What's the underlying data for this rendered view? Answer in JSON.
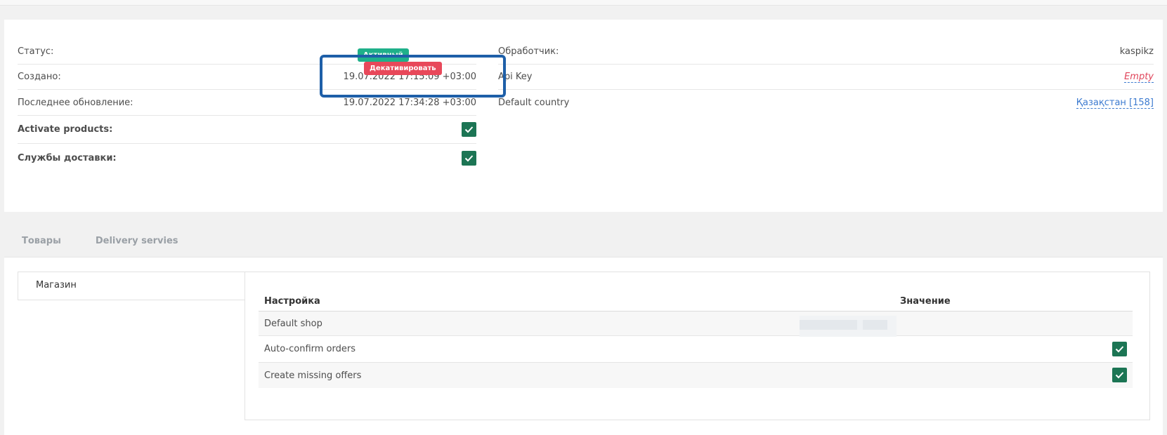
{
  "info": {
    "status_label": "Статус:",
    "status_badge": "Активный",
    "deactivate_button": "Декативировать",
    "created_label": "Создано:",
    "created_value": "19.07.2022 17:15:09 +03:00",
    "updated_label": "Последнее обновление:",
    "updated_value": "19.07.2022 17:34:28 +03:00",
    "activate_products_label": "Activate products:",
    "activate_products_checked": true,
    "delivery_services_label": "Службы доставки:",
    "delivery_services_checked": true,
    "handler_label": "Обработчик:",
    "handler_value": "kaspikz",
    "api_key_label": "Api Key",
    "api_key_value": "Empty",
    "default_country_label": "Default country",
    "default_country_value": "Қазақстан [158]"
  },
  "tabs": [
    {
      "label": "Товары"
    },
    {
      "label": "Delivery servies"
    }
  ],
  "sidebar": {
    "shop_tab": "Магазин"
  },
  "settings_table": {
    "headers": [
      "Настройка",
      "Значение"
    ],
    "rows": [
      {
        "name": "Default shop",
        "value_hidden": true
      },
      {
        "name": "Auto-confirm orders",
        "checked": true
      },
      {
        "name": "Create missing offers",
        "checked": true
      }
    ]
  },
  "colors": {
    "active_badge": "#1fb08a",
    "deactivate_badge": "#e8485a",
    "checkbox": "#1c7554",
    "highlight_box": "#1e5fa8",
    "link": "#3d7bd0",
    "empty": "#e0455b"
  }
}
